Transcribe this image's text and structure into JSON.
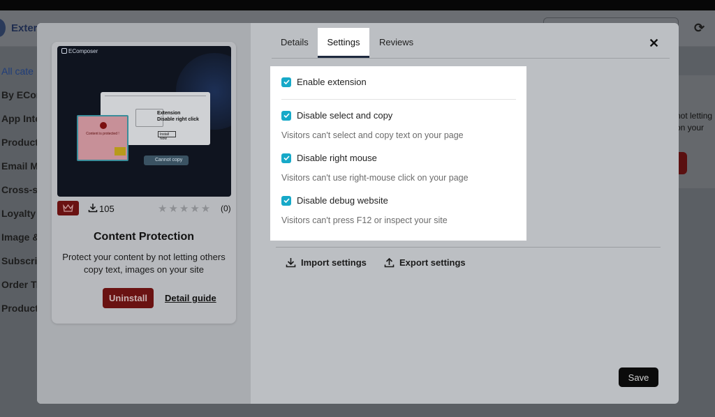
{
  "background": {
    "app_title": "Exter",
    "categories": [
      "All cate",
      "By ECon",
      "App Inte",
      "Product",
      "Email M",
      "Cross-se",
      "Loyalty",
      "Image &",
      "Subscrip",
      "Order Tr",
      "Product"
    ],
    "right_text_line1": "not letting",
    "right_text_line2": "on your"
  },
  "card": {
    "brand": "EComposer",
    "mock_title_line1": "Extension",
    "mock_title_line2": "Disable right click",
    "mock_button": "Install Now",
    "mock_alert": "Content is protected !",
    "mock_copy_chip": "Cannot copy",
    "downloads": "105",
    "rating_count": "(0)",
    "rating_stars": 0,
    "title": "Content Protection",
    "description": "Protect your content by not letting others copy text, images on your site",
    "uninstall_label": "Uninstall",
    "guide_label": "Detail guide"
  },
  "tabs": [
    {
      "label": "Details",
      "active": false
    },
    {
      "label": "Settings",
      "active": true
    },
    {
      "label": "Reviews",
      "active": false
    }
  ],
  "settings": {
    "enable_extension": {
      "label": "Enable extension",
      "checked": true
    },
    "options": [
      {
        "label": "Disable select and copy",
        "checked": true,
        "description": "Visitors can't select and copy text on your page"
      },
      {
        "label": "Disable right mouse",
        "checked": true,
        "description": "Visitors can't use right-mouse click on your page"
      },
      {
        "label": "Disable debug website",
        "checked": true,
        "description": "Visitors can't press F12 or inspect your site"
      }
    ]
  },
  "actions": {
    "import_label": "Import settings",
    "export_label": "Export settings",
    "save_label": "Save"
  },
  "colors": {
    "checkbox": "#17a9c8",
    "danger": "#6a1212",
    "primary_dark": "#0b0b0b"
  }
}
